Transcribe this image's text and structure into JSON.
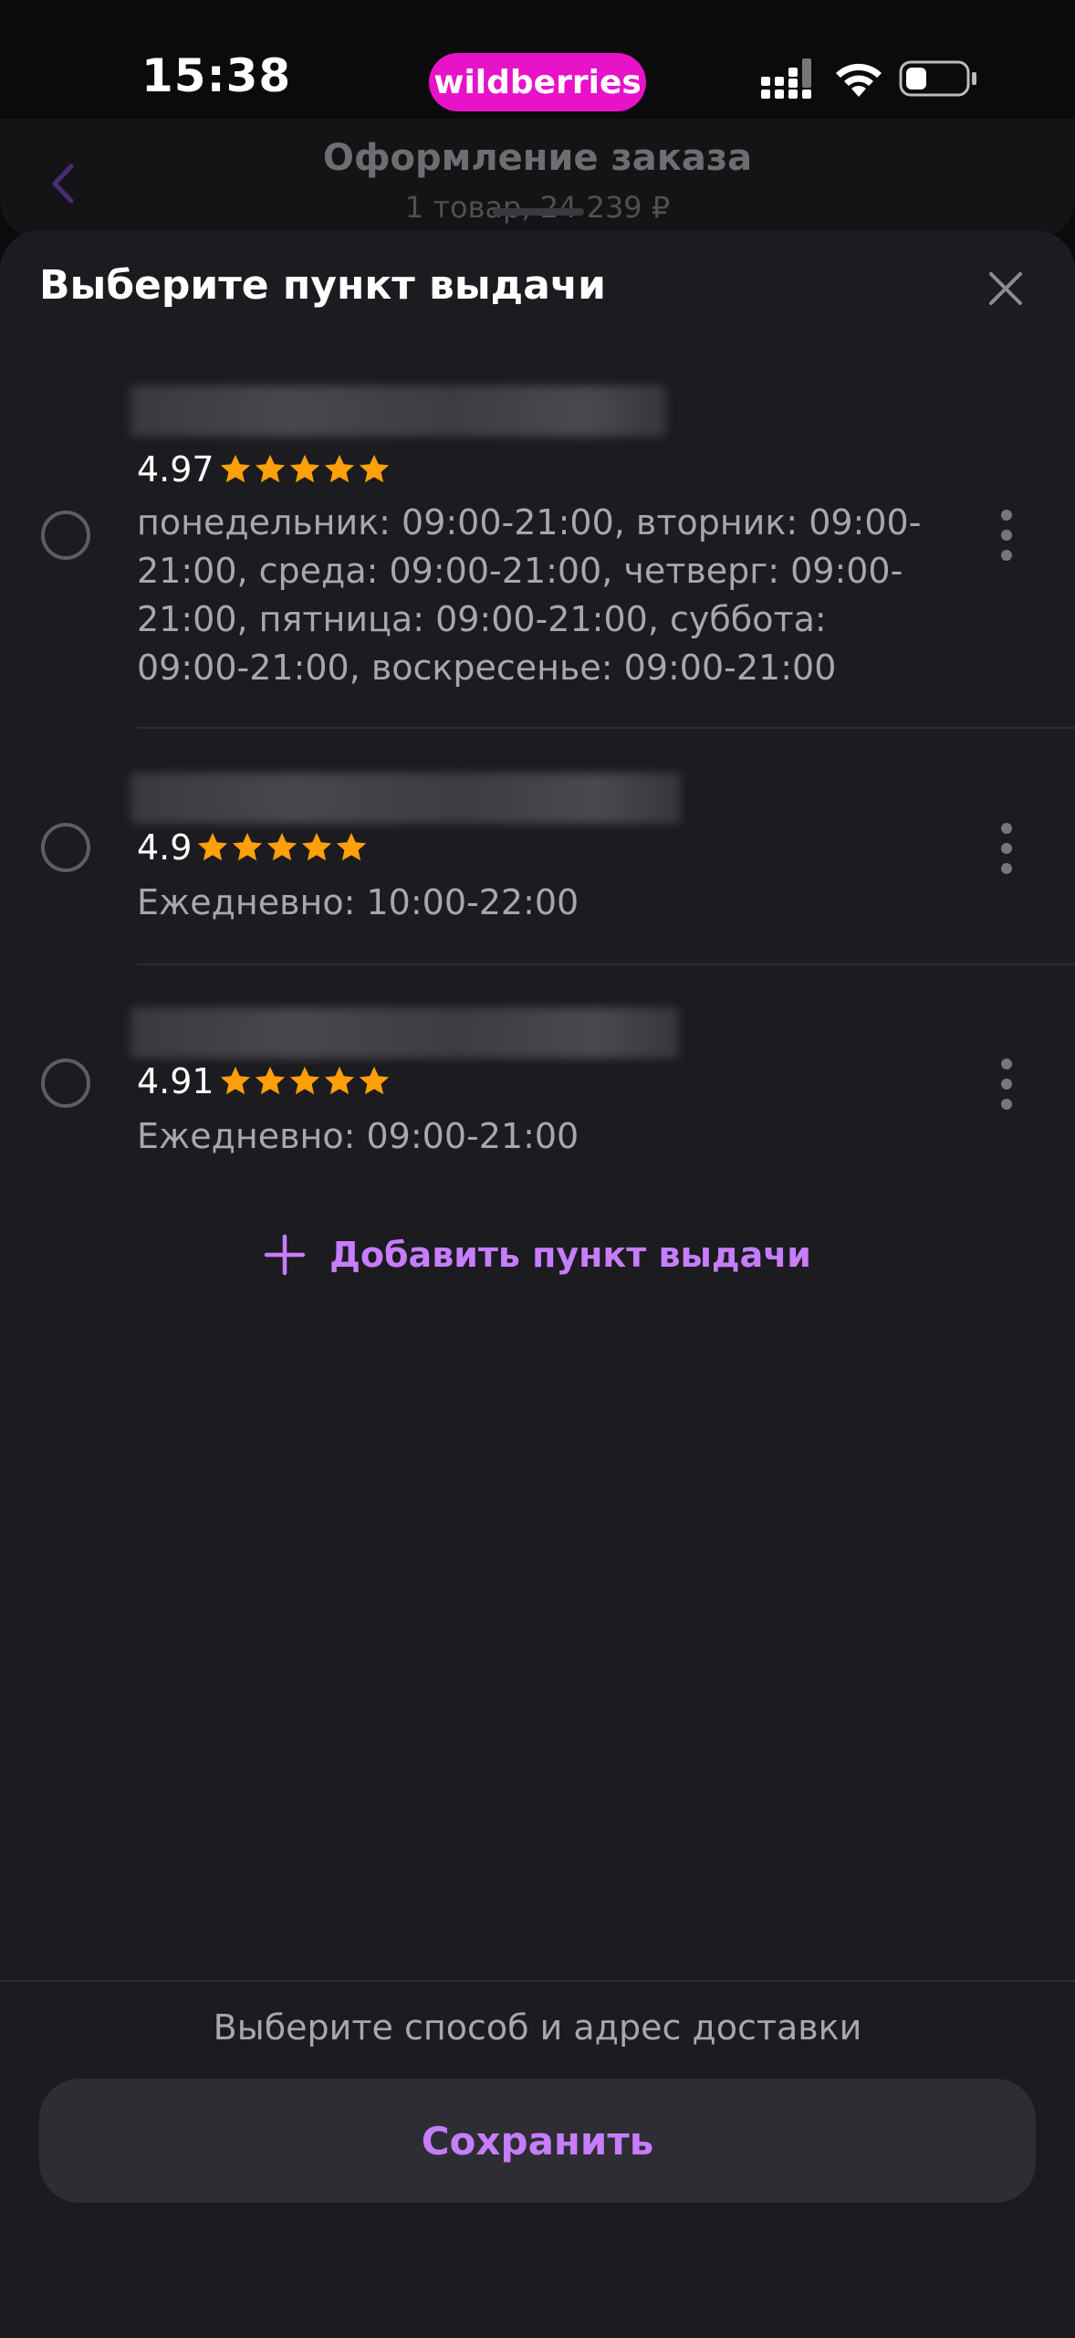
{
  "status_bar": {
    "time": "15:38",
    "brand": "wildberries",
    "brand_color": "#e812c8"
  },
  "background_header": {
    "title": "Оформление заказа",
    "subtitle": "1 товар, 24 239 ₽"
  },
  "sheet": {
    "title": "Выберите пункт выдачи",
    "pickup_points": [
      {
        "rating": "4.97",
        "stars": 5,
        "hours": "понедельник: 09:00-21:00, вторник: 09:00-21:00, среда: 09:00-21:00, четверг: 09:00-21:00, пятница: 09:00-21:00, суббота: 09:00-21:00, воскресенье: 09:00-21:00"
      },
      {
        "rating": "4.9",
        "stars": 5,
        "hours": "Ежедневно: 10:00-22:00"
      },
      {
        "rating": "4.91",
        "stars": 5,
        "hours": "Ежедневно: 09:00-21:00"
      }
    ],
    "add_pickup_label": "Добавить пункт выдачи",
    "hint": "Выберите способ и адрес доставки",
    "save_label": "Сохранить"
  },
  "colors": {
    "accent": "#c77dff",
    "star": "#ff9f0a",
    "sheet_bg": "#1c1b1f"
  },
  "icons": [
    "back-icon",
    "close-icon",
    "star-icon",
    "more-vertical-icon",
    "plus-icon",
    "signal-icon",
    "wifi-icon",
    "battery-icon"
  ]
}
